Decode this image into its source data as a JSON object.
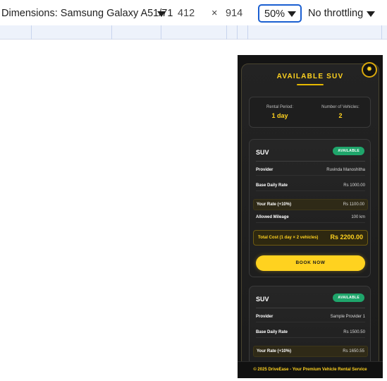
{
  "toolbar": {
    "device_label": "Dimensions: Samsung Galaxy A51/71",
    "width": "412",
    "separator": "×",
    "height": "914",
    "zoom": "50%",
    "throttling": "No throttling"
  },
  "app": {
    "title": "AVAILABLE SUV",
    "theme_icon": "sun-icon",
    "rental_period_label": "Rental Period:",
    "rental_period_value": "1 day",
    "vehicles_label": "Number of Vehicles:",
    "vehicles_value": "2",
    "cards": [
      {
        "type": "SUV",
        "status": "AVAILABLE",
        "provider_label": "Provider",
        "provider": "Ruvinda Manoshitha",
        "base_rate_label": "Base Daily Rate",
        "base_rate": "Rs 1000.00",
        "your_rate_label": "Your Rate (+10%)",
        "your_rate": "Rs 1100.00",
        "mileage_label": "Allowed Mileage",
        "mileage": "100 km",
        "total_label": "Total Cost (1 day × 2 vehicles)",
        "total": "Rs 2200.00",
        "book_label": "BOOK NOW"
      },
      {
        "type": "SUV",
        "status": "AVAILABLE",
        "provider_label": "Provider",
        "provider": "Sample Provider 1",
        "base_rate_label": "Base Daily Rate",
        "base_rate": "Rs 1500.50",
        "your_rate_label": "Your Rate (+10%)",
        "your_rate": "Rs 1650.55"
      }
    ],
    "footer": "© 2025 DriveEase - Your Premium Vehicle Rental Service"
  },
  "colors": {
    "accent": "#ffd21f",
    "badge": "#1fa56b",
    "background": "#141414",
    "zoom_border": "#1a5fd1"
  }
}
